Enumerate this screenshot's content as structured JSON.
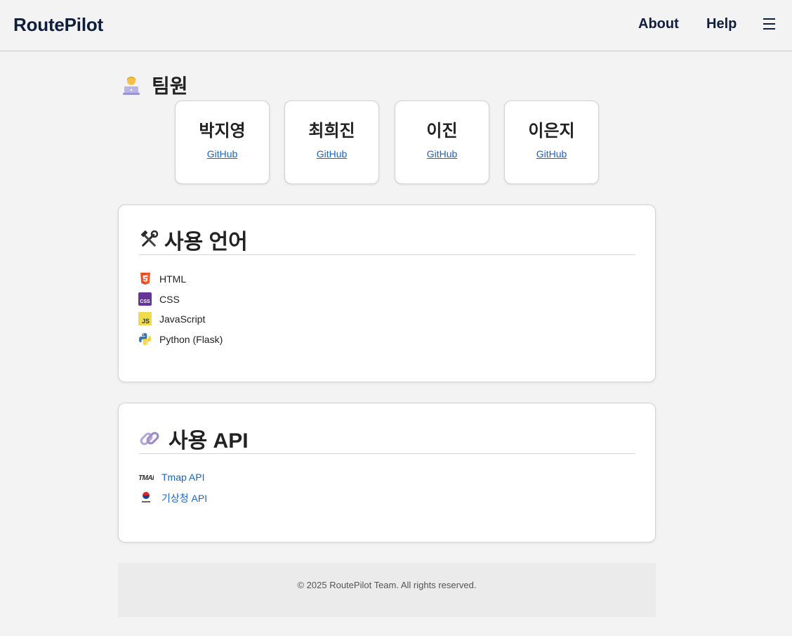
{
  "header": {
    "brand": "RoutePilot",
    "nav": {
      "about": "About",
      "help": "Help"
    },
    "menu_icon": "hamburger-icon"
  },
  "team": {
    "title": "팀원",
    "icon": "technologist-icon",
    "members": [
      {
        "name": "박지영",
        "link": "GitHub"
      },
      {
        "name": "최희진",
        "link": "GitHub"
      },
      {
        "name": "이진",
        "link": "GitHub"
      },
      {
        "name": "이은지",
        "link": "GitHub"
      }
    ]
  },
  "languages": {
    "title": "사용 언어",
    "icon": "hammer-wrench-icon",
    "items": [
      {
        "label": "HTML",
        "icon": "html5-icon",
        "color": "#e44d26"
      },
      {
        "label": "CSS",
        "icon": "css-icon",
        "color": "#663399"
      },
      {
        "label": "JavaScript",
        "icon": "javascript-icon",
        "color": "#f0db4f"
      },
      {
        "label": "Python (Flask)",
        "icon": "python-icon",
        "color": "#3776ab"
      }
    ]
  },
  "apis": {
    "title": "사용 API",
    "icon": "link-icon",
    "items": [
      {
        "label": "Tmap API",
        "icon": "tmap-logo-icon"
      },
      {
        "label": "기상청 API",
        "icon": "kma-logo-icon"
      }
    ]
  },
  "footer": {
    "text": "© 2025 RoutePilot Team. All rights reserved."
  },
  "colors": {
    "background": "#f3f3f3",
    "brand": "#0e1e3c",
    "link": "#1a64c8"
  }
}
